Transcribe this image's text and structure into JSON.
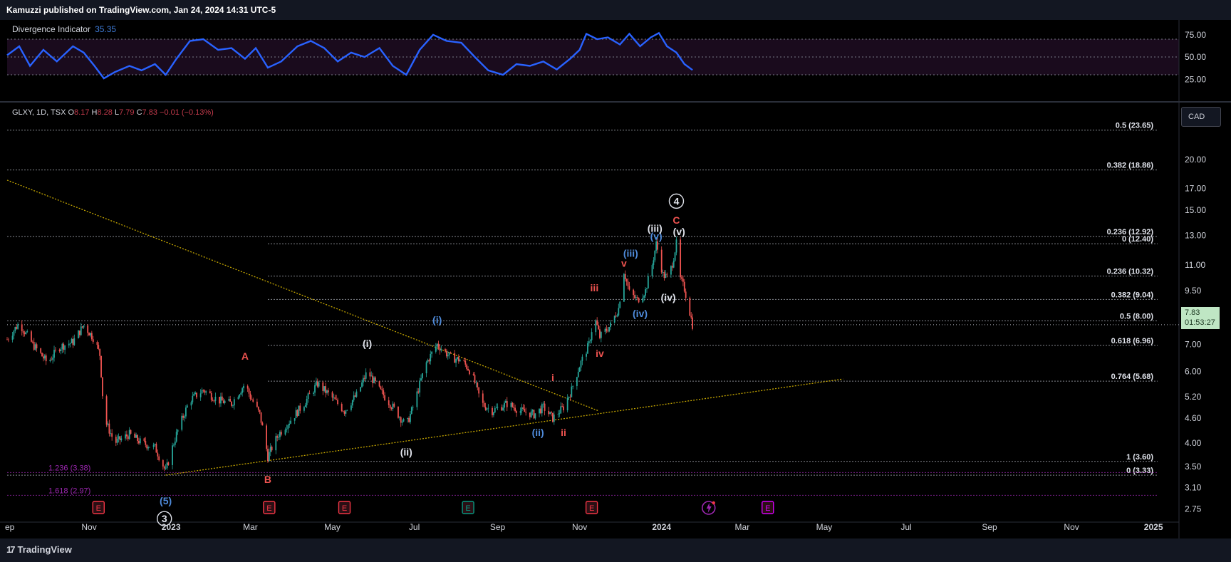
{
  "header": {
    "published_text": "Kamuzzi published on TradingView.com, Jan 24, 2024 14:31 UTC-5"
  },
  "indicator": {
    "name": "Divergence Indicator",
    "value": "35.35",
    "axis_ticks": [
      "75.00",
      "50.00",
      "25.00"
    ]
  },
  "symbol_line": {
    "symbol": "GLXY, 1D, TSX",
    "o_label": "O",
    "o": "8.17",
    "h_label": "H",
    "h": "8.28",
    "l_label": "L",
    "l": "7.79",
    "c_label": "C",
    "c": "7.83",
    "chg": "−0.01 (−0.13%)"
  },
  "currency_button": "CAD",
  "last_price": {
    "value": "7.83",
    "countdown": "01:53:27"
  },
  "branding": {
    "logo_mark": "17",
    "name": "TradingView"
  },
  "colors": {
    "background": "#000000",
    "panel": "#131722",
    "up": "#26a69a",
    "down": "#ef5350",
    "rsi_line": "#2962ff",
    "trendline": "#c6a700",
    "wave_red": "#ef5350",
    "wave_blue": "#4f8bdb",
    "wave_white": "#e0e3eb",
    "fib_purple": "#9c27b0"
  },
  "earnings_markers": [
    {
      "label": "E",
      "date": "2022-11-08",
      "color": "#f23645"
    },
    {
      "label": "E",
      "date": "2023-03-15",
      "color": "#f23645"
    },
    {
      "label": "E",
      "date": "2023-05-10",
      "color": "#f23645"
    },
    {
      "label": "E",
      "date": "2023-08-10",
      "color": "#089981"
    },
    {
      "label": "E",
      "date": "2023-11-10",
      "color": "#f23645"
    },
    {
      "label": "E",
      "date": "2024-03-20",
      "color": "#d500f9"
    }
  ],
  "dividend_marker": {
    "icon": "lightning-icon",
    "date": "2024-02-05",
    "color": "#9c27b0"
  },
  "chart_data": {
    "type": "candlestick",
    "symbol": "GLXY",
    "exchange": "TSX",
    "interval": "1D",
    "y_scale": "log",
    "ylim": [
      2.55,
      27
    ],
    "xlim": [
      "2022-09-01",
      "2025-01-20"
    ],
    "grid": false,
    "x_tick_labels": [
      {
        "label": "ep",
        "date": "2022-09-01"
      },
      {
        "label": "Nov",
        "date": "2022-11-01"
      },
      {
        "label": "2023",
        "date": "2023-01-01"
      },
      {
        "label": "Mar",
        "date": "2023-03-01"
      },
      {
        "label": "May",
        "date": "2023-05-01"
      },
      {
        "label": "Jul",
        "date": "2023-07-01"
      },
      {
        "label": "Sep",
        "date": "2023-09-01"
      },
      {
        "label": "Nov",
        "date": "2023-11-01"
      },
      {
        "label": "2024",
        "date": "2024-01-01"
      },
      {
        "label": "Mar",
        "date": "2024-03-01"
      },
      {
        "label": "May",
        "date": "2024-05-01"
      },
      {
        "label": "Jul",
        "date": "2024-07-01"
      },
      {
        "label": "Sep",
        "date": "2024-09-01"
      },
      {
        "label": "Nov",
        "date": "2024-11-01"
      },
      {
        "label": "2025",
        "date": "2025-01-01"
      }
    ],
    "y_tick_labels": [
      "20.00",
      "17.00",
      "15.00",
      "13.00",
      "11.00",
      "9.50",
      "8.00",
      "7.00",
      "6.00",
      "5.20",
      "4.60",
      "4.00",
      "3.50",
      "3.10",
      "2.75"
    ],
    "y_tick_values": [
      20,
      17,
      15,
      13,
      11,
      9.5,
      8,
      7,
      6,
      5.2,
      4.6,
      4,
      3.5,
      3.1,
      2.75
    ],
    "price_path": [
      [
        "2022-09-01",
        7.2
      ],
      [
        "2022-09-10",
        7.9
      ],
      [
        "2022-09-20",
        7.0
      ],
      [
        "2022-10-01",
        6.3
      ],
      [
        "2022-10-10",
        6.9
      ],
      [
        "2022-10-20",
        7.1
      ],
      [
        "2022-10-28",
        7.8
      ],
      [
        "2022-11-05",
        7.2
      ],
      [
        "2022-11-09",
        6.6
      ],
      [
        "2022-11-12",
        4.6
      ],
      [
        "2022-11-20",
        4.0
      ],
      [
        "2022-12-01",
        4.2
      ],
      [
        "2022-12-10",
        4.0
      ],
      [
        "2022-12-20",
        3.9
      ],
      [
        "2022-12-28",
        3.4
      ],
      [
        "2023-01-05",
        4.2
      ],
      [
        "2023-01-15",
        5.1
      ],
      [
        "2023-01-25",
        5.4
      ],
      [
        "2023-02-05",
        5.1
      ],
      [
        "2023-02-15",
        5.0
      ],
      [
        "2023-02-25",
        5.6
      ],
      [
        "2023-03-01",
        5.2
      ],
      [
        "2023-03-08",
        4.7
      ],
      [
        "2023-03-14",
        3.7
      ],
      [
        "2023-03-22",
        4.2
      ],
      [
        "2023-04-01",
        4.6
      ],
      [
        "2023-04-10",
        5.0
      ],
      [
        "2023-04-20",
        5.6
      ],
      [
        "2023-04-30",
        5.2
      ],
      [
        "2023-05-10",
        4.8
      ],
      [
        "2023-05-20",
        5.3
      ],
      [
        "2023-05-27",
        6.0
      ],
      [
        "2023-06-05",
        5.4
      ],
      [
        "2023-06-15",
        4.9
      ],
      [
        "2023-06-25",
        4.4
      ],
      [
        "2023-07-01",
        5.0
      ],
      [
        "2023-07-10",
        6.3
      ],
      [
        "2023-07-18",
        7.0
      ],
      [
        "2023-07-28",
        6.5
      ],
      [
        "2023-08-05",
        6.4
      ],
      [
        "2023-08-12",
        6.0
      ],
      [
        "2023-08-20",
        5.0
      ],
      [
        "2023-08-28",
        4.8
      ],
      [
        "2023-09-08",
        5.0
      ],
      [
        "2023-09-18",
        4.8
      ],
      [
        "2023-09-28",
        4.7
      ],
      [
        "2023-10-05",
        4.9
      ],
      [
        "2023-10-12",
        4.6
      ],
      [
        "2023-10-20",
        4.9
      ],
      [
        "2023-10-26",
        5.4
      ],
      [
        "2023-11-01",
        6.2
      ],
      [
        "2023-11-08",
        7.0
      ],
      [
        "2023-11-12",
        8.2
      ],
      [
        "2023-11-16",
        7.3
      ],
      [
        "2023-11-24",
        7.8
      ],
      [
        "2023-11-30",
        8.6
      ],
      [
        "2023-12-04",
        10.6
      ],
      [
        "2023-12-08",
        9.4
      ],
      [
        "2023-12-14",
        9.0
      ],
      [
        "2023-12-20",
        9.5
      ],
      [
        "2023-12-25",
        11.0
      ],
      [
        "2023-12-28",
        12.4
      ],
      [
        "2024-01-02",
        10.4
      ],
      [
        "2024-01-06",
        10.2
      ],
      [
        "2024-01-09",
        11.1
      ],
      [
        "2024-01-12",
        12.4
      ],
      [
        "2024-01-14",
        10.3
      ],
      [
        "2024-01-18",
        9.6
      ],
      [
        "2024-01-22",
        8.4
      ],
      [
        "2024-01-24",
        7.83
      ]
    ],
    "rsi_series": [
      [
        "2022-09-01",
        52
      ],
      [
        "2022-09-10",
        62
      ],
      [
        "2022-09-18",
        40
      ],
      [
        "2022-09-28",
        58
      ],
      [
        "2022-10-08",
        45
      ],
      [
        "2022-10-20",
        62
      ],
      [
        "2022-10-28",
        55
      ],
      [
        "2022-11-05",
        40
      ],
      [
        "2022-11-12",
        26
      ],
      [
        "2022-11-20",
        33
      ],
      [
        "2022-12-01",
        40
      ],
      [
        "2022-12-10",
        35
      ],
      [
        "2022-12-20",
        42
      ],
      [
        "2022-12-28",
        30
      ],
      [
        "2023-01-05",
        48
      ],
      [
        "2023-01-15",
        68
      ],
      [
        "2023-01-25",
        70
      ],
      [
        "2023-02-05",
        58
      ],
      [
        "2023-02-15",
        60
      ],
      [
        "2023-02-25",
        48
      ],
      [
        "2023-03-05",
        60
      ],
      [
        "2023-03-14",
        38
      ],
      [
        "2023-03-24",
        45
      ],
      [
        "2023-04-05",
        62
      ],
      [
        "2023-04-15",
        68
      ],
      [
        "2023-04-25",
        60
      ],
      [
        "2023-05-05",
        45
      ],
      [
        "2023-05-15",
        55
      ],
      [
        "2023-05-25",
        50
      ],
      [
        "2023-06-05",
        60
      ],
      [
        "2023-06-15",
        40
      ],
      [
        "2023-06-25",
        30
      ],
      [
        "2023-07-05",
        58
      ],
      [
        "2023-07-15",
        75
      ],
      [
        "2023-07-25",
        68
      ],
      [
        "2023-08-05",
        66
      ],
      [
        "2023-08-15",
        50
      ],
      [
        "2023-08-25",
        35
      ],
      [
        "2023-09-05",
        30
      ],
      [
        "2023-09-15",
        42
      ],
      [
        "2023-09-25",
        40
      ],
      [
        "2023-10-05",
        45
      ],
      [
        "2023-10-15",
        36
      ],
      [
        "2023-10-25",
        48
      ],
      [
        "2023-11-01",
        58
      ],
      [
        "2023-11-06",
        76
      ],
      [
        "2023-11-14",
        70
      ],
      [
        "2023-11-22",
        72
      ],
      [
        "2023-12-01",
        64
      ],
      [
        "2023-12-08",
        76
      ],
      [
        "2023-12-16",
        62
      ],
      [
        "2023-12-24",
        72
      ],
      [
        "2023-12-30",
        77
      ],
      [
        "2024-01-05",
        62
      ],
      [
        "2024-01-12",
        55
      ],
      [
        "2024-01-18",
        42
      ],
      [
        "2024-01-24",
        35.35
      ]
    ],
    "rsi_ylim": [
      10,
      90
    ],
    "rsi_levels": [
      70,
      50,
      30
    ],
    "fib_levels": [
      {
        "label": "0.5 (23.65)",
        "price": 23.65,
        "start": "2022-09-01",
        "color": "#b2b5be"
      },
      {
        "label": "0.382 (18.86)",
        "price": 18.86,
        "start": "2022-09-01",
        "color": "#b2b5be"
      },
      {
        "label": "0.236 (12.92)",
        "price": 12.92,
        "start": "2022-09-01",
        "color": "#b2b5be"
      },
      {
        "label": "0 (12.40)",
        "price": 12.4,
        "start": "2023-03-14",
        "color": "#b2b5be"
      },
      {
        "label": "0.236 (10.32)",
        "price": 10.32,
        "start": "2023-03-14",
        "color": "#b2b5be"
      },
      {
        "label": "0.382 (9.04)",
        "price": 9.04,
        "start": "2023-03-14",
        "color": "#b2b5be"
      },
      {
        "label": "0.5 (8.00)",
        "price": 8.0,
        "start": "2022-09-01",
        "color": "#b2b5be"
      },
      {
        "label": "0.618 (6.96)",
        "price": 6.96,
        "start": "2023-03-14",
        "color": "#b2b5be"
      },
      {
        "label": "0.764 (5.68)",
        "price": 5.68,
        "start": "2023-03-14",
        "color": "#b2b5be"
      },
      {
        "label": "1 (3.60)",
        "price": 3.6,
        "start": "2023-03-14",
        "color": "#b2b5be"
      },
      {
        "label": "0 (3.33)",
        "price": 3.33,
        "start": "2022-09-01",
        "color": "#b2b5be"
      },
      {
        "label": "1.236 (3.38)",
        "price": 3.38,
        "start": "2022-09-01",
        "color": "#9c27b0",
        "label_side": "left"
      },
      {
        "label": "1.618 (2.97)",
        "price": 2.97,
        "start": "2022-09-01",
        "color": "#9c27b0",
        "label_side": "left"
      }
    ],
    "trendlines": [
      {
        "from": [
          "2022-09-01",
          17.8
        ],
        "to": [
          "2023-11-15",
          4.8
        ],
        "color": "#c6a700"
      },
      {
        "from": [
          "2022-12-28",
          3.33
        ],
        "to": [
          "2024-05-15",
          5.75
        ],
        "color": "#c6a700"
      }
    ],
    "wave_labels": [
      {
        "text": "(5)",
        "date": "2022-12-28",
        "price": 2.88,
        "color": "#4f8bdb"
      },
      {
        "text": "3",
        "date": "2022-12-27",
        "price": 2.6,
        "color": "#e0e3eb",
        "circled": true
      },
      {
        "text": "A",
        "date": "2023-02-25",
        "price": 6.55,
        "color": "#ef5350"
      },
      {
        "text": "B",
        "date": "2023-03-14",
        "price": 3.25,
        "color": "#ef5350"
      },
      {
        "text": "(i)",
        "date": "2023-05-27",
        "price": 7.05,
        "color": "#e0e3eb"
      },
      {
        "text": "(ii)",
        "date": "2023-06-25",
        "price": 3.8,
        "color": "#e0e3eb"
      },
      {
        "text": "(i)",
        "date": "2023-07-18",
        "price": 8.05,
        "color": "#4f8bdb"
      },
      {
        "text": "(ii)",
        "date": "2023-10-01",
        "price": 4.25,
        "color": "#4f8bdb"
      },
      {
        "text": "i",
        "date": "2023-10-12",
        "price": 5.8,
        "color": "#ef5350"
      },
      {
        "text": "ii",
        "date": "2023-10-20",
        "price": 4.25,
        "color": "#ef5350"
      },
      {
        "text": "iii",
        "date": "2023-11-12",
        "price": 9.65,
        "color": "#ef5350"
      },
      {
        "text": "iv",
        "date": "2023-11-16",
        "price": 6.65,
        "color": "#ef5350"
      },
      {
        "text": "v",
        "date": "2023-12-04",
        "price": 11.1,
        "color": "#ef5350"
      },
      {
        "text": "(iii)",
        "date": "2023-12-09",
        "price": 11.75,
        "color": "#4f8bdb"
      },
      {
        "text": "(iv)",
        "date": "2023-12-16",
        "price": 8.35,
        "color": "#4f8bdb"
      },
      {
        "text": "(v)",
        "date": "2023-12-28",
        "price": 12.95,
        "color": "#4f8bdb"
      },
      {
        "text": "(iii)",
        "date": "2023-12-27",
        "price": 13.55,
        "color": "#e0e3eb"
      },
      {
        "text": "(iv)",
        "date": "2024-01-06",
        "price": 9.15,
        "color": "#e0e3eb"
      },
      {
        "text": "(v)",
        "date": "2024-01-14",
        "price": 13.3,
        "color": "#e0e3eb"
      },
      {
        "text": "C",
        "date": "2024-01-12",
        "price": 14.2,
        "color": "#ef5350"
      },
      {
        "text": "4",
        "date": "2024-01-12",
        "price": 15.8,
        "color": "#e0e3eb",
        "circled": true
      }
    ]
  }
}
